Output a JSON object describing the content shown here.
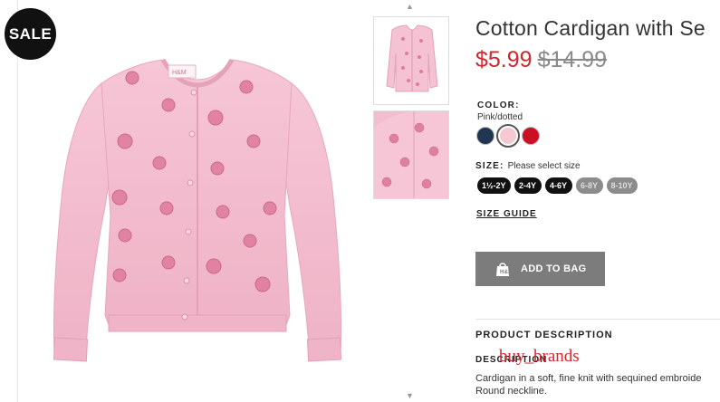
{
  "badge": {
    "sale": "SALE"
  },
  "product": {
    "title": "Cotton Cardigan with Se",
    "sale_price": "$5.99",
    "original_price": "$14.99"
  },
  "color": {
    "label": "COLOR:",
    "selected": "Pink/dotted",
    "swatches": [
      {
        "name": "navy",
        "hex": "#1f3551"
      },
      {
        "name": "pink",
        "hex": "#f6c8cf"
      },
      {
        "name": "red",
        "hex": "#cc1024"
      }
    ]
  },
  "size": {
    "label": "SIZE:",
    "hint": "Please select size",
    "options": [
      {
        "label": "1½-2Y",
        "available": true
      },
      {
        "label": "2-4Y",
        "available": true
      },
      {
        "label": "4-6Y",
        "available": true
      },
      {
        "label": "6-8Y",
        "available": false
      },
      {
        "label": "8-10Y",
        "available": false
      }
    ],
    "guide": "SIZE GUIDE"
  },
  "actions": {
    "add_to_bag": "ADD TO BAG"
  },
  "description": {
    "heading": "PRODUCT DESCRIPTION",
    "subheading": "DESCRIPTION",
    "lines": [
      "Cardigan in a soft, fine knit with sequined embroide",
      "Round neckline."
    ]
  },
  "watermark": "buy_brands",
  "colors": {
    "accent_red": "#d0262d",
    "garment_pink": "#f3b9cb",
    "button_grey": "#7c7c7c"
  },
  "icons": {
    "arrow_up": "chevron-up-icon",
    "arrow_down": "chevron-down-icon",
    "bag": "shopping-bag-icon"
  }
}
